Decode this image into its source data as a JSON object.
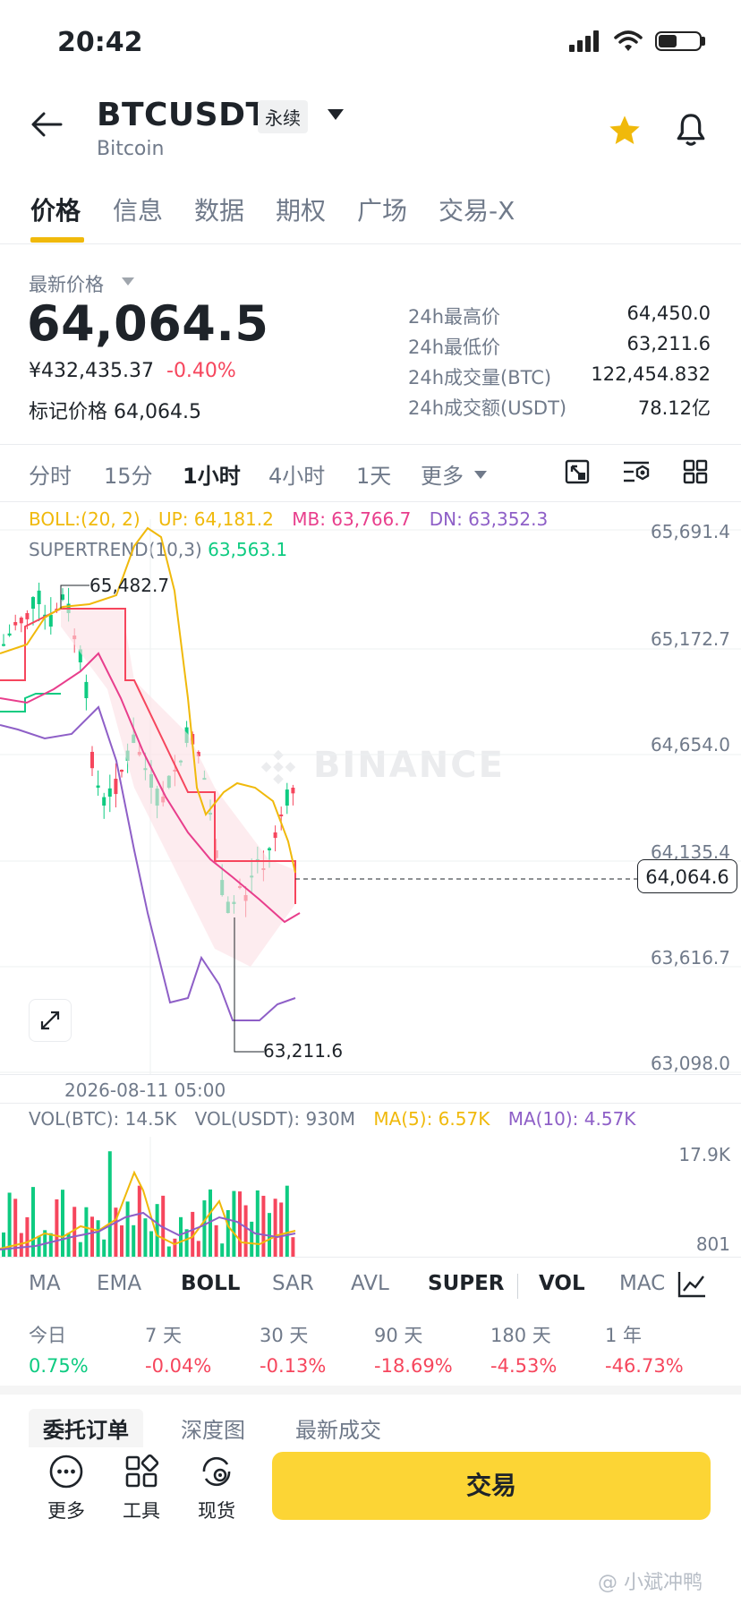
{
  "status_bar": {
    "time": "20:42"
  },
  "header": {
    "symbol": "BTCUSDT",
    "contract_type": "永续",
    "name": "Bitcoin"
  },
  "tabs": [
    "价格",
    "信息",
    "数据",
    "期权",
    "广场",
    "交易-X"
  ],
  "ticker": {
    "latest_label": "最新价格",
    "last_price": "64,064.5",
    "cny_price": "¥432,435.37",
    "change_pct": "-0.40%",
    "mark_label": "标记价格",
    "mark_price": "64,064.5",
    "stats": [
      {
        "label": "24h最高价",
        "value": "64,450.0"
      },
      {
        "label": "24h最低价",
        "value": "63,211.6"
      },
      {
        "label": "24h成交量(BTC)",
        "value": "122,454.832"
      },
      {
        "label": "24h成交额(USDT)",
        "value": "78.12亿"
      }
    ]
  },
  "intervals": [
    "分时",
    "15分",
    "1小时",
    "4小时",
    "1天",
    "更多"
  ],
  "indicators": {
    "boll_label": "BOLL:(20, 2)",
    "boll_up": "UP: 64,181.2",
    "boll_mb": "MB: 63,766.7",
    "boll_dn": "DN: 63,352.3",
    "supertrend_label": "SUPERTREND(10,3)",
    "supertrend_value": "63,563.1"
  },
  "chart": {
    "watermark": "BINANCE",
    "price_axis": [
      "65,691.4",
      "65,172.7",
      "64,654.0",
      "64,135.4",
      "63,616.7",
      "63,098.0"
    ],
    "current_price_tag": "64,064.6",
    "high_label": "65,482.7",
    "low_label": "63,211.6",
    "time_label": "2026-08-11 05:00"
  },
  "volume": {
    "vol_btc": "VOL(BTC): 14.5K",
    "vol_usdt": "VOL(USDT): 930M",
    "ma5": "MA(5): 6.57K",
    "ma10": "MA(10): 4.57K",
    "axis_top": "17.9K",
    "axis_bottom": "801"
  },
  "indicator_tabs": [
    "MA",
    "EMA",
    "BOLL",
    "SAR",
    "AVL",
    "SUPER",
    "VOL",
    "MAC"
  ],
  "performance": [
    {
      "label": "今日",
      "value": "0.75%"
    },
    {
      "label": "7 天",
      "value": "-0.04%"
    },
    {
      "label": "30 天",
      "value": "-0.13%"
    },
    {
      "label": "90 天",
      "value": "-18.69%"
    },
    {
      "label": "180 天",
      "value": "-4.53%"
    },
    {
      "label": "1 年",
      "value": "-46.73%"
    }
  ],
  "bottom_tabs": [
    "委托订单",
    "深度图",
    "最新成交"
  ],
  "footer": {
    "more": "更多",
    "tools": "工具",
    "spot": "现货",
    "trade": "交易"
  },
  "watermark_footer": "@ 小斌冲鸭",
  "colors": {
    "up": "#0ecb81",
    "down": "#f6465d",
    "boll_up": "#f0b90b",
    "boll_mb": "#e83e8c",
    "boll_dn": "#8e5fc7",
    "brand": "#fcd535"
  }
}
